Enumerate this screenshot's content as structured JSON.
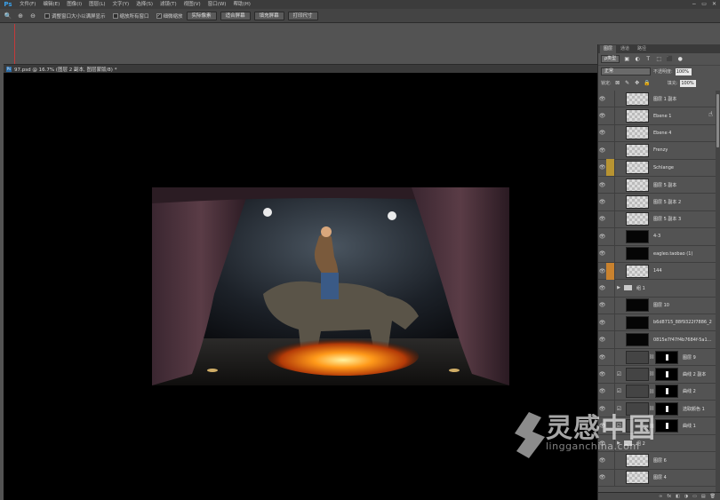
{
  "app": {
    "logo": "Ps"
  },
  "menu": [
    "文件(F)",
    "编辑(E)",
    "图像(I)",
    "图层(L)",
    "文字(Y)",
    "选择(S)",
    "滤镜(T)",
    "视图(V)",
    "窗口(W)",
    "帮助(H)"
  ],
  "window_controls": {
    "minimize": "−",
    "maximize": "▭",
    "close": "✕"
  },
  "options": {
    "zoom_icon": "🔍",
    "zoom_in": "⊕",
    "zoom_out": "⊖",
    "checkbox_resize": "调整窗口大小以满屏显示",
    "checkbox_all_windows": "缩放所有窗口",
    "checkbox_scrubby": "细微缩放",
    "btn_actual": "实际像素",
    "btn_fit": "适合屏幕",
    "btn_fill": "填充屏幕",
    "btn_print": "打印尺寸"
  },
  "document": {
    "icon": "Ps",
    "title": "97.psd @ 16.7% (图层 2 副本, 图层蒙版/8) *"
  },
  "panel": {
    "tabs": [
      "图层",
      "通道",
      "路径"
    ],
    "kind_select": "ρ类型",
    "tools": [
      "▣",
      "◐",
      "T",
      "⬚",
      "⬛",
      "●"
    ],
    "blend_mode": "正常",
    "opacity_label": "不透明度:",
    "opacity_value": "100%",
    "lock_label": "锁定:",
    "lock_icons": [
      "⊠",
      "✎",
      "✥",
      "🔒"
    ],
    "fill_label": "填充:",
    "fill_value": "100%",
    "footer_icons": [
      "∞",
      "fx",
      "◧",
      "◑",
      "▭",
      "▤",
      "🗑"
    ]
  },
  "layers": [
    {
      "name": "图层 1 副本",
      "thumb": "checker",
      "color": ""
    },
    {
      "name": "Ebene 1",
      "thumb": "checker",
      "color": ""
    },
    {
      "name": "Ebene 4",
      "thumb": "checker",
      "color": ""
    },
    {
      "name": "Frenzy",
      "thumb": "checker",
      "color": ""
    },
    {
      "name": "Schlange",
      "thumb": "checker",
      "color": "yellow"
    },
    {
      "name": "图层 5 副本",
      "thumb": "checker",
      "color": ""
    },
    {
      "name": "图层 5 副本 2",
      "thumb": "checker",
      "color": ""
    },
    {
      "name": "图层 5 副本 3",
      "thumb": "checker",
      "color": ""
    },
    {
      "name": "4-3",
      "thumb": "dark",
      "color": ""
    },
    {
      "name": "eagleo.taobao (1)",
      "thumb": "dark",
      "color": ""
    },
    {
      "name": "144",
      "thumb": "checker",
      "color": "orange"
    },
    {
      "name": "组 1",
      "group": true
    },
    {
      "name": "图层 10",
      "thumb": "dark",
      "color": ""
    },
    {
      "name": "b6d8715_88f9322f7886_2",
      "thumb": "dark",
      "color": ""
    },
    {
      "name": "0815e7f47f4b7684f-5a1b15e...",
      "thumb": "dark",
      "color": ""
    },
    {
      "name": "图层 9",
      "thumb": "gray",
      "mask": true,
      "color": ""
    },
    {
      "name": "曲线 2 副本",
      "adj": true,
      "mask": true,
      "color": ""
    },
    {
      "name": "曲线 2",
      "adj": true,
      "mask": true,
      "color": ""
    },
    {
      "name": "选取颜色 1",
      "adj": true,
      "mask": true,
      "color": ""
    },
    {
      "name": "曲线 1",
      "adj": true,
      "mask": true,
      "color": ""
    },
    {
      "name": "组 2",
      "group": true
    },
    {
      "name": "图层 6",
      "thumb": "checker",
      "color": ""
    },
    {
      "name": "图层 4",
      "thumb": "checker",
      "color": ""
    }
  ],
  "watermark": {
    "cn": "灵感中国",
    "en": "lingganchina.com"
  },
  "colors": {
    "menu_bg": "#3c3c3c",
    "ps_blue": "#3aa0e8",
    "guide_red": "#c43a3a",
    "canvas_bg": "#000000",
    "fire": "#ff8a1a"
  }
}
